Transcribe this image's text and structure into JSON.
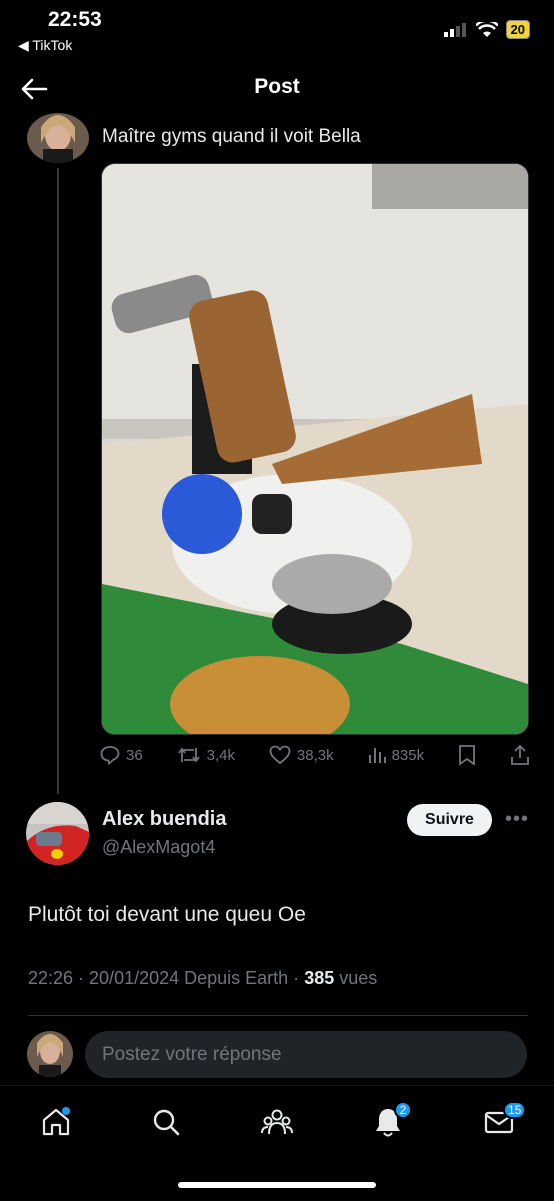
{
  "status": {
    "time": "22:53",
    "back_app": "◀ TikTok",
    "battery": "20"
  },
  "header": {
    "title": "Post"
  },
  "parent_tweet": {
    "text": "Maître gyms quand il voit Bella"
  },
  "actions": {
    "replies": "36",
    "retweets": "3,4k",
    "likes": "38,3k",
    "views": "835k"
  },
  "reply": {
    "author_name": "Alex buendia",
    "author_handle": "@AlexMagot4",
    "follow_label": "Suivre",
    "text": "Plutôt toi devant une queu Oe",
    "meta_prefix": "22:26 · 20/01/2024 Depuis Earth · ",
    "views_count": "385",
    "views_label": " vues"
  },
  "composer": {
    "placeholder": "Postez votre réponse"
  },
  "tabbar": {
    "notifications_badge": "2",
    "messages_badge": "15"
  },
  "colors": {
    "accent": "#1d9bf0",
    "background": "#000000",
    "muted": "#71767b"
  }
}
